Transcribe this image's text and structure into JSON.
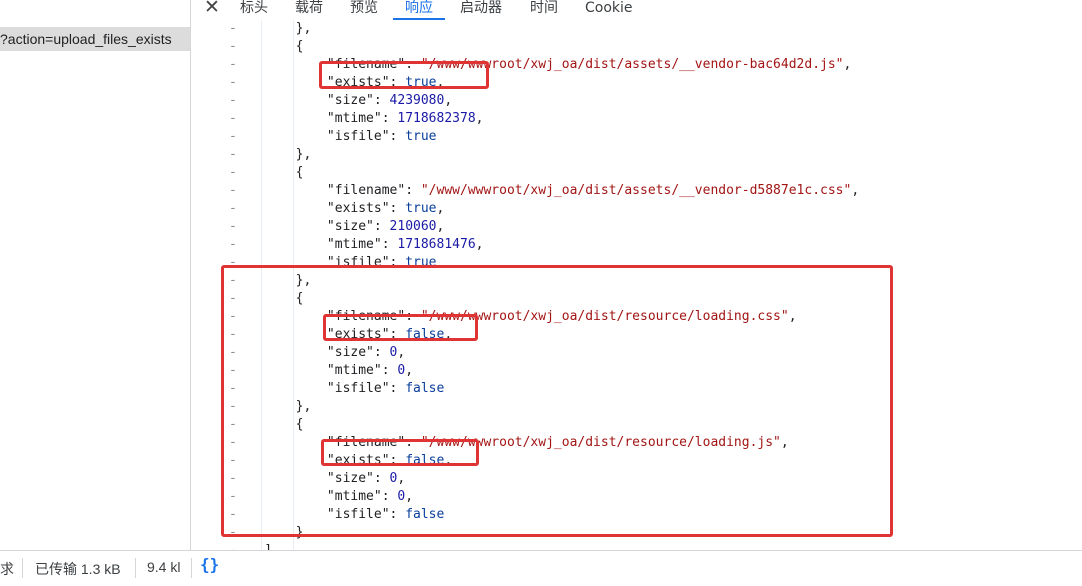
{
  "request": {
    "label": "?action=upload_files_exists"
  },
  "tabs": [
    {
      "label": "标头"
    },
    {
      "label": "载荷"
    },
    {
      "label": "预览"
    },
    {
      "label": "响应"
    },
    {
      "label": "启动器"
    },
    {
      "label": "时间"
    },
    {
      "label": "Cookie"
    }
  ],
  "active_tab": "响应",
  "code_lines": [
    {
      "indent": "        ",
      "text": "},"
    },
    {
      "indent": "        ",
      "text": "{"
    },
    {
      "indent": "            ",
      "key": "\"filename\"",
      "value": "\"/www/wwwroot/xwj_oa/dist/assets/__vendor-bac64d2d.js\"",
      "vtype": "s",
      "comma": ","
    },
    {
      "indent": "            ",
      "key": "\"exists\"",
      "value": "true",
      "vtype": "b",
      "comma": ","
    },
    {
      "indent": "            ",
      "key": "\"size\"",
      "value": "4239080",
      "vtype": "n",
      "comma": ","
    },
    {
      "indent": "            ",
      "key": "\"mtime\"",
      "value": "1718682378",
      "vtype": "n",
      "comma": ","
    },
    {
      "indent": "            ",
      "key": "\"isfile\"",
      "value": "true",
      "vtype": "b",
      "comma": ""
    },
    {
      "indent": "        ",
      "text": "},"
    },
    {
      "indent": "        ",
      "text": "{"
    },
    {
      "indent": "            ",
      "key": "\"filename\"",
      "value": "\"/www/wwwroot/xwj_oa/dist/assets/__vendor-d5887e1c.css\"",
      "vtype": "s",
      "comma": ","
    },
    {
      "indent": "            ",
      "key": "\"exists\"",
      "value": "true",
      "vtype": "b",
      "comma": ","
    },
    {
      "indent": "            ",
      "key": "\"size\"",
      "value": "210060",
      "vtype": "n",
      "comma": ","
    },
    {
      "indent": "            ",
      "key": "\"mtime\"",
      "value": "1718681476",
      "vtype": "n",
      "comma": ","
    },
    {
      "indent": "            ",
      "key": "\"isfile\"",
      "value": "true",
      "vtype": "b",
      "comma": ""
    },
    {
      "indent": "        ",
      "text": "},"
    },
    {
      "indent": "        ",
      "text": "{"
    },
    {
      "indent": "            ",
      "key": "\"filename\"",
      "value": "\"/www/wwwroot/xwj_oa/dist/resource/loading.css\"",
      "vtype": "s",
      "comma": ","
    },
    {
      "indent": "            ",
      "key": "\"exists\"",
      "value": "false",
      "vtype": "b",
      "comma": ","
    },
    {
      "indent": "            ",
      "key": "\"size\"",
      "value": "0",
      "vtype": "n",
      "comma": ","
    },
    {
      "indent": "            ",
      "key": "\"mtime\"",
      "value": "0",
      "vtype": "n",
      "comma": ","
    },
    {
      "indent": "            ",
      "key": "\"isfile\"",
      "value": "false",
      "vtype": "b",
      "comma": ""
    },
    {
      "indent": "        ",
      "text": "},"
    },
    {
      "indent": "        ",
      "text": "{"
    },
    {
      "indent": "            ",
      "key": "\"filename\"",
      "value": "\"/www/wwwroot/xwj_oa/dist/resource/loading.js\"",
      "vtype": "s",
      "comma": ","
    },
    {
      "indent": "            ",
      "key": "\"exists\"",
      "value": "false",
      "vtype": "b",
      "comma": ","
    },
    {
      "indent": "            ",
      "key": "\"size\"",
      "value": "0",
      "vtype": "n",
      "comma": ","
    },
    {
      "indent": "            ",
      "key": "\"mtime\"",
      "value": "0",
      "vtype": "n",
      "comma": ","
    },
    {
      "indent": "            ",
      "key": "\"isfile\"",
      "value": "false",
      "vtype": "b",
      "comma": ""
    },
    {
      "indent": "        ",
      "text": "}"
    },
    {
      "indent": "    ",
      "text": "]"
    }
  ],
  "gutter_marker": "-",
  "status_bar": {
    "requests": "求",
    "transferred": "已传输 1.3 kB",
    "resources": "9.4 kl",
    "format_icon": "{}"
  },
  "colors": {
    "highlight": "#e03333",
    "accent": "#1a73e8"
  }
}
